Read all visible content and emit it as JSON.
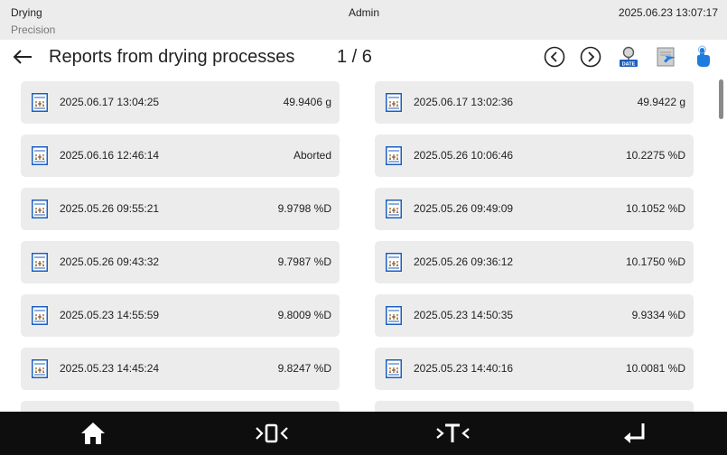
{
  "status": {
    "mode": "Drying",
    "profile": "Precision",
    "user": "Admin",
    "datetime": "2025.06.23 13:07:17"
  },
  "header": {
    "title": "Reports from drying processes",
    "pager": "1 / 6",
    "back_icon": "arrow-left-icon",
    "buttons": [
      "prev-page-icon",
      "next-page-icon",
      "search-by-date-icon",
      "export-report-icon",
      "touch-select-icon"
    ]
  },
  "reports": [
    {
      "datetime": "2025.06.17 13:04:25",
      "result": "49.9406 g"
    },
    {
      "datetime": "2025.06.17 13:02:36",
      "result": "49.9422 g"
    },
    {
      "datetime": "2025.06.16 12:46:14",
      "result": "Aborted"
    },
    {
      "datetime": "2025.05.26 10:06:46",
      "result": "10.2275 %D"
    },
    {
      "datetime": "2025.05.26 09:55:21",
      "result": "9.9798 %D"
    },
    {
      "datetime": "2025.05.26 09:49:09",
      "result": "10.1052 %D"
    },
    {
      "datetime": "2025.05.26 09:43:32",
      "result": "9.7987 %D"
    },
    {
      "datetime": "2025.05.26 09:36:12",
      "result": "10.1750 %D"
    },
    {
      "datetime": "2025.05.23 14:55:59",
      "result": "9.8009 %D"
    },
    {
      "datetime": "2025.05.23 14:50:35",
      "result": "9.9334 %D"
    },
    {
      "datetime": "2025.05.23 14:45:24",
      "result": "9.8247 %D"
    },
    {
      "datetime": "2025.05.23 14:40:16",
      "result": "10.0081 %D"
    },
    {
      "datetime": "",
      "result": ""
    },
    {
      "datetime": "",
      "result": ""
    }
  ],
  "footer": {
    "buttons": [
      "home-icon",
      "zero-icon",
      "tare-icon",
      "enter-icon"
    ]
  },
  "colors": {
    "accent": "#1e7be0",
    "tile_bg": "#ececec",
    "footer_bg": "#0e0e0e"
  }
}
